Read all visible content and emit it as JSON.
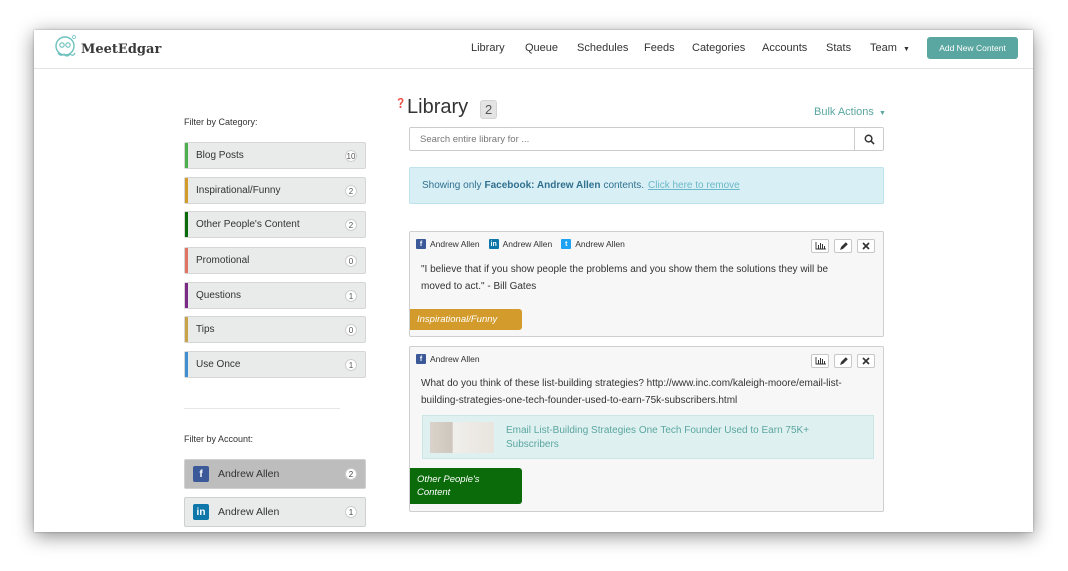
{
  "app": {
    "name": "MeetEdgar"
  },
  "nav": {
    "items": [
      "Library",
      "Queue",
      "Schedules",
      "Feeds",
      "Categories",
      "Accounts",
      "Stats",
      "Team"
    ],
    "add_button": "Add New Content"
  },
  "sidebar": {
    "category_heading": "Filter by Category:",
    "categories": [
      {
        "label": "Blog Posts",
        "count": "10",
        "color": "#4cae4c"
      },
      {
        "label": "Inspirational/Funny",
        "count": "2",
        "color": "#d39b2c"
      },
      {
        "label": "Other People's Content",
        "count": "2",
        "color": "#0b6b0b"
      },
      {
        "label": "Promotional",
        "count": "0",
        "color": "#e07563"
      },
      {
        "label": "Questions",
        "count": "1",
        "color": "#7b2b87"
      },
      {
        "label": "Tips",
        "count": "0",
        "color": "#c8a34a"
      },
      {
        "label": "Use Once",
        "count": "1",
        "color": "#3f8fd0"
      }
    ],
    "account_heading": "Filter by Account:",
    "accounts": [
      {
        "label": "Andrew Allen",
        "count": "2",
        "network": "facebook"
      },
      {
        "label": "Andrew Allen",
        "count": "1",
        "network": "linkedin"
      }
    ]
  },
  "library": {
    "title": "Library",
    "count": "2",
    "bulk_actions": "Bulk Actions",
    "search_placeholder": "Search entire library for ...",
    "notice": {
      "prefix": "Showing only",
      "filter": "Facebook: Andrew Allen",
      "suffix": "contents.",
      "link": "Click here to remove"
    },
    "items": [
      {
        "accounts": [
          {
            "name": "Andrew Allen",
            "network": "facebook"
          },
          {
            "name": "Andrew Allen",
            "network": "linkedin"
          },
          {
            "name": "Andrew Allen",
            "network": "twitter"
          }
        ],
        "text_line1": "\"I believe that if you show people the problems and you show them the solutions they will be",
        "text_line2": "moved to act.\" - Bill Gates",
        "category": "Inspirational/Funny",
        "category_color": "#d39b2c"
      },
      {
        "accounts": [
          {
            "name": "Andrew Allen",
            "network": "facebook"
          }
        ],
        "text_line1": "What do you think of these list-building strategies? http://www.inc.com/kaleigh-moore/email-list-",
        "text_line2": "building-strategies-one-tech-founder-used-to-earn-75k-subscribers.html",
        "link_title": "Email List-Building Strategies One Tech Founder Used to Earn 75K+ Subscribers",
        "category_line1": "Other People's",
        "category_line2": "Content",
        "category_color": "#0b6b0b"
      }
    ]
  },
  "colors": {
    "accent": "#5aa6a0",
    "facebook": "#3b5998",
    "linkedin": "#0e76a8",
    "twitter": "#1da1f2"
  },
  "icons": [
    "octopus-logo-icon",
    "caret-down-icon",
    "help-icon",
    "search-icon",
    "facebook-icon",
    "linkedin-icon",
    "twitter-icon",
    "stats-icon",
    "edit-icon",
    "delete-icon"
  ]
}
